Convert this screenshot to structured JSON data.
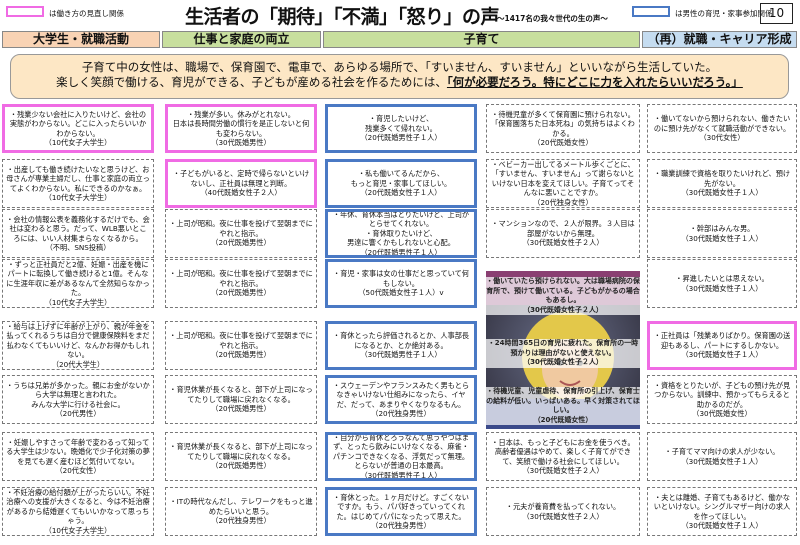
{
  "header": {
    "title": "生活者の「期待」「不満」「怒り」の声",
    "subtitle": "～1417名の我々世代の生の声～",
    "page_number": "10",
    "legend": [
      {
        "label": "は働き方の見直し関係",
        "color": "#f06be4"
      },
      {
        "label": "は男性の育児・家事参加関係",
        "color": "#4a79c4"
      }
    ]
  },
  "categories": [
    {
      "label": "大学生・就職活動",
      "bg": "#f9d3b4"
    },
    {
      "label": "仕事と家庭の両立",
      "bg": "#c8df9e"
    },
    {
      "label": "子育て",
      "bg": "#c8df9e"
    },
    {
      "label": "（再）就職・キャリア形成",
      "bg": "#c5dcf0"
    }
  ],
  "intro": {
    "line1": "子育て中の女性は、職場で、保育園で、電車で、あらゆる場所で、「すいません、すいません」といいながら生活していた。",
    "line2_plain": "楽しく笑顔で働ける、育児ができる、子どもが産める社会を作るためには、",
    "line2_em": "「何が必要だろう。特にどこに力を入れたらいいだろう。」"
  },
  "columns": [
    [
      {
        "text": "・残業少ない会社に入りたいけど、会社の実態がわからない。どこに入ったらいいかわからない。\n（10代女子大学生）",
        "style": "pink"
      },
      {
        "text": "・出産しても働き続けたいなと思うけど、お母さんが専業主婦だし、仕事と家庭の両立ってよくわからない。私にできるのかなぁ。\n（10代女子大学生）",
        "style": "plain"
      },
      {
        "text": "・会社の情報公表を義務化するだけでも、会社は変わると思う。だって、WLB悪いところには、いい人材集まらなくなるから。\n（不明、SNS投稿）",
        "style": "plain"
      },
      {
        "text": "・ずっと正社員だと2億、妊娠・出産を機にパートに転換して働き続けると1億。そんなに生涯年収に差があるなんて全然知らなかった。\n（10代女子大学生）",
        "style": "plain"
      },
      {
        "text": "・給与は上げずに年齢が上がり、親が年金を払ってくれるうちは自分で健康保険料をまだ払わなくてもいいけど、なんかお得かもしれない。\n（20代大学生）",
        "style": "plain"
      },
      {
        "text": "・うちは兄弟が多かった。親にお金がないから大学は無理と言われた。\nみんな大学に行ける社会に。\n（20代男性）",
        "style": "plain"
      },
      {
        "text": "・妊娠しやすさって年齢で変わるって知ってる大学生は少ない。晩婚化で少子化対策の夢を見ても遅く産むほど気付いてない。\n（20代女性）",
        "style": "plain"
      },
      {
        "text": "・不妊治療の給付額が上がったらいい。不妊治療への支援が大きくなると、今は不妊治療があるから結婚遅くてもいいかなって思っちゃう。\n（10代女子大学生）",
        "style": "plain"
      }
    ],
    [
      {
        "text": "・残業が多い。休みがとれない。\n日本は長時間労働の慣行を是正しないと何も変わらない。\n（30代既婚男性）",
        "style": "pink"
      },
      {
        "text": "・子どもがいると、定時で帰らないといけないし、正社員は無理と判断。\n（40代既婚女性子２人）",
        "style": "pink"
      },
      {
        "text": "・上司が昭和。夜に仕事を投げて翌朝までにやれと指示。\n（20代既婚男性）",
        "style": "plain"
      },
      {
        "text": "・上司が昭和。夜に仕事を投げて翌朝までにやれと指示。\n（20代既婚男性）",
        "style": "plain"
      },
      {
        "text": "・上司が昭和。夜に仕事を投げて翌朝までにやれと指示。\n（20代既婚男性）",
        "style": "plain"
      },
      {
        "text": "・育児休業が長くなると、部下が上司になってたりして職場に戻れなくなる。\n（20代既婚男性）",
        "style": "plain"
      },
      {
        "text": "・育児休業が長くなると、部下が上司になってたりして職場に戻れなくなる。\n（20代既婚男性）",
        "style": "plain"
      },
      {
        "text": "・ITの時代なんだし、テレワークをもっと進めたらいいと思う。\n（20代独身男性）",
        "style": "plain"
      }
    ],
    [
      {
        "text": "・育児したいけど、\n残業多くて帰れない。\n（20代既婚男性子１人）",
        "style": "blue"
      },
      {
        "text": "・私も働いてるんだから、\nもっと育児・家事してほしい。\n（20代既婚女性子１人）",
        "style": "blue"
      },
      {
        "text": "・年休、育休本当はとりたいけど、上司がとらせてくれない。\n・育休取りたいけど、\n男達に響くかもしれないと心配。\n（20代既婚男性子１人）",
        "style": "blue"
      },
      {
        "text": "・育児・家事は女の仕事だと思っていて何もしない。\n（50代既婚女性子１人）v",
        "style": "blue"
      },
      {
        "text": "・育休とったら評価されるとか、人事部長になるとか、とか絶対ある。\n（30代既婚男性子１人）",
        "style": "blue"
      },
      {
        "text": "・スウェーデンやフランスみたく男もとらなきゃいけない仕組みになったら、イヤだ、だって、あまりやくなりなるもん。\n（20代独身男性）",
        "style": "blue"
      },
      {
        "text": "・自分から育休とろうなんて思うやつはまず、とったら飲みにいけなくなる、麻雀・パチンコできなくなる、浮気だって無理。とらないが普通の日本最高。\n（30代既婚男性子１人）",
        "style": "blue"
      },
      {
        "text": "・育休とった。１ヶ月だけど。すごくないですか。もう、パパ好きっていってくれた。はじめてパパになったって思えた。\n（20代独身男性）",
        "style": "blue"
      }
    ],
    [
      {
        "text": "・待機児童が多くて保育園に預けられない。「保育園落ちた日本死ね」の気持ちはよくわかる。\n（20代既婚女性）",
        "style": "plain"
      },
      {
        "text": "・ベビーカー出してるメートル歩くごとに、「すいません、すいません」って謝らないといけない日本を変えてほしい。子育てってそんなに悪いことですか。\n（20代独身女性）",
        "style": "plain"
      },
      {
        "text": "・マンションなので、２人が限界。３人目は部屋がないから無理。\n（30代既婚女性子２人）",
        "style": "plain"
      },
      {
        "text": "・働いていたら預けられない。大はマンションに職場がある病院の保育所で、預けて働いている。子どもがかるの場合もあるし。\n（30代既婚女性子２人）",
        "style": "plain"
      },
      {
        "text": "・24時間365日の育児に疲れた。保育所の一時預かりは理由がないと使えない。\n（30代既婚女性子２人）",
        "style": "plain"
      },
      {
        "text": "・待機児童、児童虐待、保育所の引上げ、保育士の給料が低い。いっぱいある。早く対策されてほしい。\n（20代既婚女性）",
        "style": "plain"
      },
      {
        "text": "・日本は、もっと子どもにお金を使うべき。高齢者優遇はやめて、楽しく子育てができて、笑顔で働ける社会にしてほしい。\n（30代既婚女性子２人）",
        "style": "plain"
      },
      {
        "text": "・元夫が養育費を払ってくれない。\n（30代既婚女性子２人）",
        "style": "plain"
      }
    ],
    [
      {
        "text": "・働いてないから預けられない、働きたいのに預け先がなくて就職活動ができない。\n（30代女性）",
        "style": "plain"
      },
      {
        "text": "・職業訓練で資格を取りたいけれど、預け先がない。\n（30代既婚女性子１人）",
        "style": "plain"
      },
      {
        "text": "・幹部はみんな男。\n（30代既婚女性子１人）",
        "style": "plain"
      },
      {
        "text": "・昇進したいとは思えない。\n（30代既婚女性子１人）",
        "style": "plain"
      },
      {
        "text": "・正社員は「残業ありばかり。保育園の送迎もあるし、パートにするしかない。\n（30代既婚女性子１人）",
        "style": "pink"
      },
      {
        "text": "・資格をとりたいが、子どもの預け先が見つからない。訓練中、預かってもらえると助かるのだが。\n（30代既婚女性）",
        "style": "plain"
      },
      {
        "text": "・子育てママ向けの求人が少ない。\n（30代既婚女性子１人）",
        "style": "plain"
      },
      {
        "text": "・夫とは離婚、子育てもあるけど、働かないといけない。シングルマザー向けの求人を作ってほしい。\n（30代既婚女性子１人）",
        "style": "plain"
      }
    ]
  ],
  "photo_captions": {
    "top": "・働いていたら預けられない。大は職場病院の保育所で、預けて働いている。子どもがかるの場合もあるし。\n（30代既婚女性子２人）",
    "mid": "・24時間365日の育児に疲れた。保育所の一時預かりは理由がないと使えない。\n（30代既婚女性子２人）",
    "bot": "・待機児童、児童虐待、保育所の引上げ、保育士の給料が低い。いっぱいある。早く対策されてほしい。\n（20代既婚女性）"
  }
}
